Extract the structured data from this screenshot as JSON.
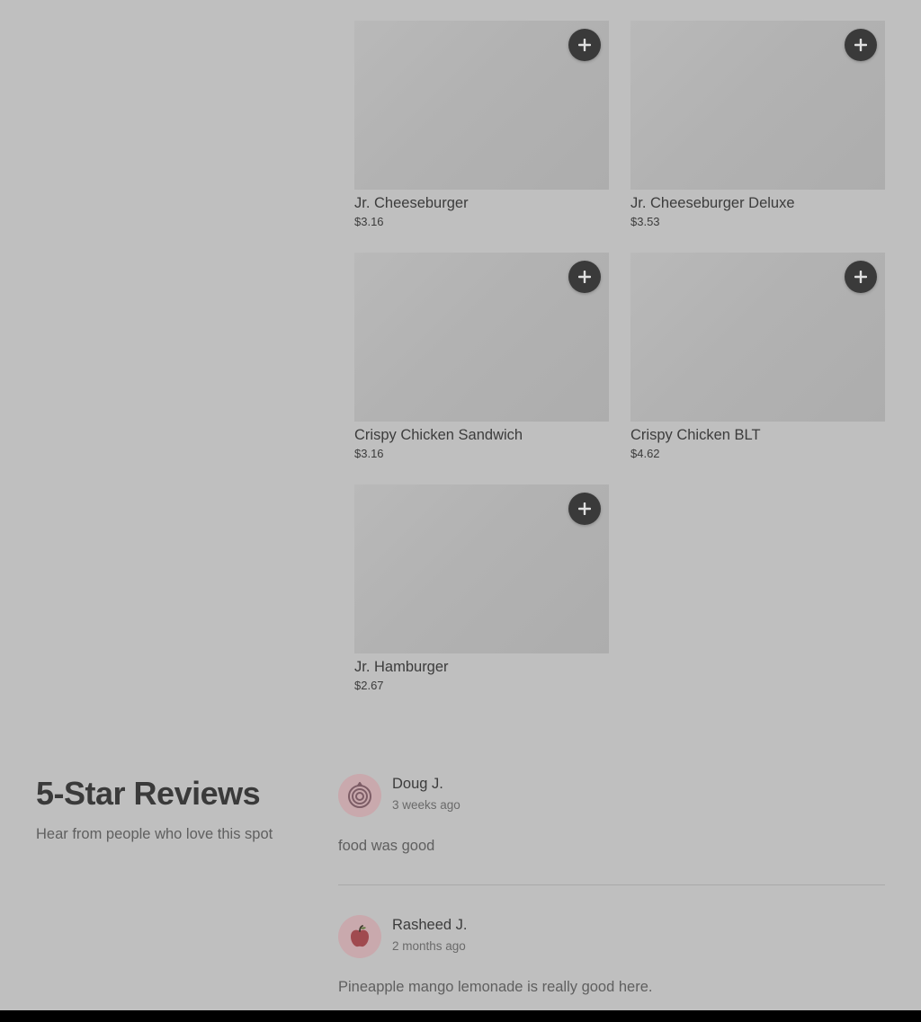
{
  "menu_items": [
    {
      "name": "Jr. Cheeseburger",
      "price": "$3.16"
    },
    {
      "name": "Jr. Cheeseburger Deluxe",
      "price": "$3.53"
    },
    {
      "name": "Crispy Chicken Sandwich",
      "price": "$3.16"
    },
    {
      "name": "Crispy Chicken BLT",
      "price": "$4.62"
    },
    {
      "name": "Jr. Hamburger",
      "price": "$2.67"
    }
  ],
  "add_icon": "plus-icon",
  "reviews": {
    "title": "5-Star Reviews",
    "subtitle": "Hear from people who love this spot",
    "items": [
      {
        "author": "Doug J.",
        "time": "3 weeks ago",
        "text": "food was good",
        "avatar_icon": "onion-icon"
      },
      {
        "author": "Rasheed J.",
        "time": "2 months ago",
        "text": "Pineapple mango lemonade is really good here.",
        "avatar_icon": "apple-icon"
      }
    ]
  },
  "colors": {
    "background": "#bfbfbf",
    "add_button": "#3a3a3a",
    "avatar_bg": "#c9a9ad"
  }
}
